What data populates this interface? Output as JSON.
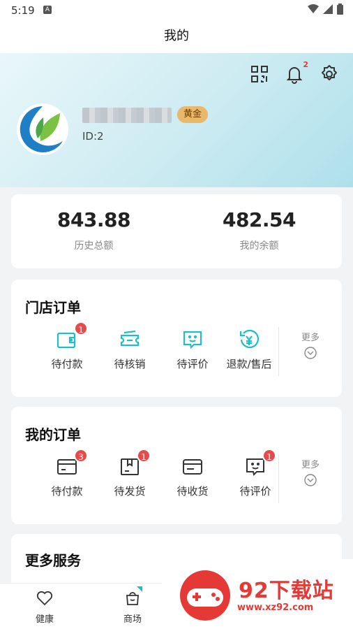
{
  "status_bar": {
    "time": "5:19",
    "a_icon": "A"
  },
  "title_bar": {
    "title": "我的"
  },
  "profile": {
    "notification_count": "2",
    "level": "黄金",
    "user_id": "ID:2"
  },
  "balance": {
    "history_total_value": "843.88",
    "history_total_label": "历史总额",
    "my_balance_value": "482.54",
    "my_balance_label": "我的余额"
  },
  "store_orders": {
    "title": "门店订单",
    "items": [
      {
        "label": "待付款",
        "badge": "1",
        "icon": "wallet-icon"
      },
      {
        "label": "待核销",
        "badge": "",
        "icon": "ticket-icon"
      },
      {
        "label": "待评价",
        "badge": "",
        "icon": "review-icon"
      },
      {
        "label": "退款/售后",
        "badge": "",
        "icon": "refund-icon"
      }
    ],
    "more_label": "更多"
  },
  "my_orders": {
    "title": "我的订单",
    "items": [
      {
        "label": "待付款",
        "badge": "3",
        "icon": "card-icon"
      },
      {
        "label": "待发货",
        "badge": "1",
        "icon": "package-icon"
      },
      {
        "label": "待收货",
        "badge": "",
        "icon": "receive-icon"
      },
      {
        "label": "待评价",
        "badge": "1",
        "icon": "review-icon"
      }
    ],
    "more_label": "更多"
  },
  "services": {
    "title": "更多服务"
  },
  "tabbar": {
    "tabs": [
      {
        "label": "健康",
        "icon": "heart-icon"
      },
      {
        "label": "商场",
        "icon": "shopping-bag-icon"
      }
    ]
  },
  "watermark": {
    "title": "92下载站",
    "url": "www.xz92.com"
  },
  "colors": {
    "accent": "#1bbfc7",
    "badge": "#e64a4a",
    "gold": "#e9b86a"
  }
}
